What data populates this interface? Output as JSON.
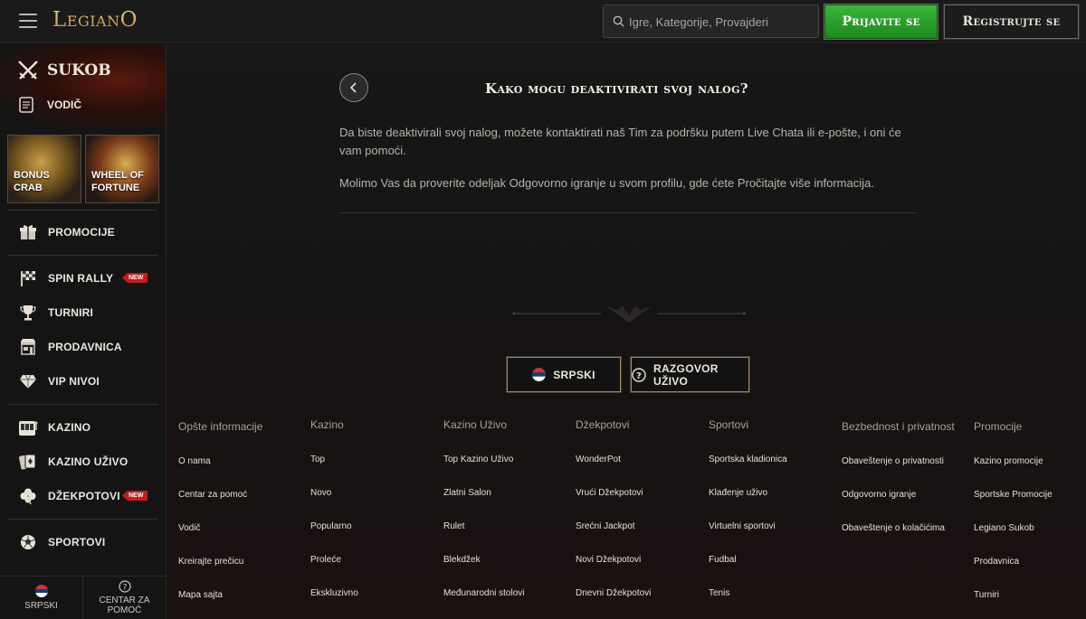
{
  "header": {
    "logo": "LegianO",
    "search_placeholder": "Igre, Kategorije, Provajderi",
    "login_label": "Prijavite se",
    "register_label": "Registrujte se"
  },
  "sidebar": {
    "sukob": "SUKOB",
    "vodic": "VODIČ",
    "tiles": [
      {
        "line1": "BONUS",
        "line2": "CRAB"
      },
      {
        "line1": "WHEEL OF",
        "line2": "FORTUNE"
      }
    ],
    "items": [
      {
        "label": "PROMOCIJE",
        "icon": "gift-icon"
      },
      {
        "label": "SPIN RALLY",
        "icon": "checkered-flag-icon",
        "badge": "NEW"
      },
      {
        "label": "TURNIRI",
        "icon": "trophy-icon"
      },
      {
        "label": "PRODAVNICA",
        "icon": "shop-icon"
      },
      {
        "label": "VIP NIVOI",
        "icon": "diamond-icon"
      },
      {
        "label": "KAZINO",
        "icon": "slot-machine-icon"
      },
      {
        "label": "KAZINO UŽIVO",
        "icon": "cards-icon"
      },
      {
        "label": "DŽEKPOTOVI",
        "icon": "clover-icon",
        "badge": "NEW"
      },
      {
        "label": "SPORTOVI",
        "icon": "ball-icon"
      }
    ],
    "bottom": {
      "language": "SRPSKI",
      "help_line1": "CENTAR ZA",
      "help_line2": "POMOĆ"
    }
  },
  "article": {
    "title": "Kako mogu deaktivirati svoj nalog?",
    "paragraph1": "Da biste deaktivirali svoj nalog, možete kontaktirati naš Tim za podršku putem Live Chata ili e-pošte, i oni će vam pomoći.",
    "paragraph2": "Molimo Vas da proverite odeljak Odgovorno igranje u svom profilu, gde ćete Pročitajte više informacija."
  },
  "footer": {
    "language_button": "SRPSKI",
    "chat_button": "RAZGOVOR UŽIVO",
    "columns": [
      {
        "heading": "Opšte informacije",
        "links": [
          "O nama",
          "Centar za pomoć",
          "Vodič",
          "Kreirajte prečicu",
          "Mapa sajta"
        ]
      },
      {
        "heading": "Kazino",
        "links": [
          "Top",
          "Novo",
          "Popularno",
          "Proleće",
          "Ekskluzivno"
        ]
      },
      {
        "heading": "Kazino Uživo",
        "links": [
          "Top Kazino Uživo",
          "Zlatni Salon",
          "Rulet",
          "Blekdžek",
          "Međunarodni stolovi"
        ]
      },
      {
        "heading": "Džekpotovi",
        "links": [
          "WonderPot",
          "Vrući Džekpotovi",
          "Srećni Jackpot",
          "Novi Džekpotovi",
          "Dnevni Džekpotovi"
        ]
      },
      {
        "heading": "Sportovi",
        "links": [
          "Sportska kladionica",
          "Klađenje uživo",
          "Virtuelni sportovi",
          "Fudbal",
          "Tenis"
        ]
      },
      {
        "heading": "Bezbednost i privatnost",
        "links": [
          "Obaveštenje o privatnosti",
          "Odgovorno igranje",
          "Obaveštenje o kolačićima"
        ]
      },
      {
        "heading": "Promocije",
        "links": [
          "Kazino promocije",
          "Sportske Promocije",
          "Legiano Sukob",
          "Prodavnica",
          "Turniri"
        ]
      }
    ]
  },
  "colors": {
    "accent_gold": "#d8b36a",
    "login_green": "#2ea82e",
    "badge_red": "#c41b1b",
    "background": "#141414"
  }
}
